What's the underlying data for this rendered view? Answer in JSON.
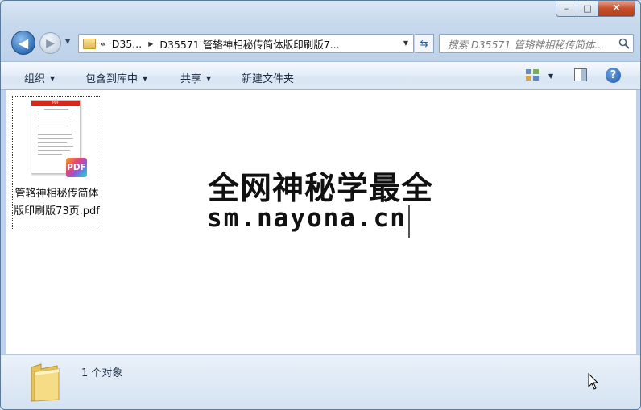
{
  "window": {
    "caption_buttons": {
      "minimize": "–",
      "maximize": "□",
      "close": "✕"
    }
  },
  "nav": {
    "back_icon": "arrow-left-icon",
    "forward_icon": "arrow-right-icon",
    "address": {
      "chevron": "«",
      "segments": [
        "D35...",
        "D35571 管辂神相秘传简体版印刷版7..."
      ]
    },
    "search": {
      "placeholder": "搜索 D35571 管辂神相秘传简体..."
    }
  },
  "toolbar": {
    "organize": "组织",
    "include_in_library": "包含到库中",
    "share": "共享",
    "new_folder": "新建文件夹"
  },
  "files": [
    {
      "name": "管辂神相秘传简体版印刷版73页.pdf",
      "badge": "PDF",
      "thumb_band": "PDF"
    }
  ],
  "watermark": {
    "line1": "全网神秘学最全",
    "line2": "sm.nayona.cn"
  },
  "status": {
    "text": "1 个对象"
  },
  "colors": {
    "accent": "#2f6db8",
    "pdf_red": "#d7261b"
  }
}
